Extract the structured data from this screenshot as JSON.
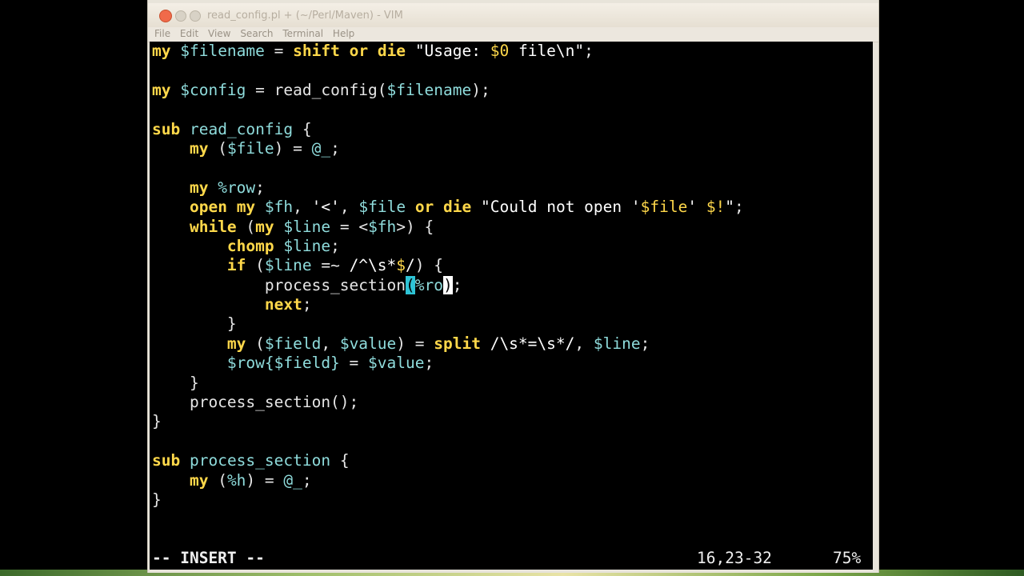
{
  "window": {
    "title": "read_config.pl + (~/Perl/Maven) - VIM"
  },
  "menubar": {
    "items": [
      "File",
      "Edit",
      "View",
      "Search",
      "Terminal",
      "Help"
    ]
  },
  "editor": {
    "lines": [
      [
        [
          "kw",
          "my"
        ],
        [
          "plain",
          " "
        ],
        [
          "var",
          "$filename"
        ],
        [
          "plain",
          " = "
        ],
        [
          "kw",
          "shift"
        ],
        [
          "plain",
          " "
        ],
        [
          "kw",
          "or"
        ],
        [
          "plain",
          " "
        ],
        [
          "kw",
          "die"
        ],
        [
          "plain",
          " "
        ],
        [
          "str",
          "\"Usage: "
        ],
        [
          "strvar",
          "$0"
        ],
        [
          "str",
          " file\\n\""
        ],
        [
          "plain",
          ";"
        ]
      ],
      [],
      [
        [
          "kw",
          "my"
        ],
        [
          "plain",
          " "
        ],
        [
          "var",
          "$config"
        ],
        [
          "plain",
          " = read_config("
        ],
        [
          "var",
          "$filename"
        ],
        [
          "plain",
          ");"
        ]
      ],
      [],
      [
        [
          "kw",
          "sub"
        ],
        [
          "plain",
          " "
        ],
        [
          "fn",
          "read_config"
        ],
        [
          "plain",
          " {"
        ]
      ],
      [
        [
          "plain",
          "    "
        ],
        [
          "kw",
          "my"
        ],
        [
          "plain",
          " ("
        ],
        [
          "var",
          "$file"
        ],
        [
          "plain",
          ") = "
        ],
        [
          "var",
          "@_"
        ],
        [
          "plain",
          ";"
        ]
      ],
      [],
      [
        [
          "plain",
          "    "
        ],
        [
          "kw",
          "my"
        ],
        [
          "plain",
          " "
        ],
        [
          "var",
          "%row"
        ],
        [
          "plain",
          ";"
        ]
      ],
      [
        [
          "plain",
          "    "
        ],
        [
          "kw",
          "open"
        ],
        [
          "plain",
          " "
        ],
        [
          "kw",
          "my"
        ],
        [
          "plain",
          " "
        ],
        [
          "var",
          "$fh"
        ],
        [
          "plain",
          ", "
        ],
        [
          "str",
          "'<'"
        ],
        [
          "plain",
          ", "
        ],
        [
          "var",
          "$file"
        ],
        [
          "plain",
          " "
        ],
        [
          "kw",
          "or"
        ],
        [
          "plain",
          " "
        ],
        [
          "kw",
          "die"
        ],
        [
          "plain",
          " "
        ],
        [
          "str",
          "\"Could not open '"
        ],
        [
          "strvar",
          "$file"
        ],
        [
          "str",
          "' "
        ],
        [
          "strvar",
          "$!"
        ],
        [
          "str",
          "\""
        ],
        [
          "plain",
          ";"
        ]
      ],
      [
        [
          "plain",
          "    "
        ],
        [
          "kw",
          "while"
        ],
        [
          "plain",
          " ("
        ],
        [
          "kw",
          "my"
        ],
        [
          "plain",
          " "
        ],
        [
          "var",
          "$line"
        ],
        [
          "plain",
          " = <"
        ],
        [
          "var",
          "$fh"
        ],
        [
          "plain",
          ">) {"
        ]
      ],
      [
        [
          "plain",
          "        "
        ],
        [
          "kw",
          "chomp"
        ],
        [
          "plain",
          " "
        ],
        [
          "var",
          "$line"
        ],
        [
          "plain",
          ";"
        ]
      ],
      [
        [
          "plain",
          "        "
        ],
        [
          "kw",
          "if"
        ],
        [
          "plain",
          " ("
        ],
        [
          "var",
          "$line"
        ],
        [
          "plain",
          " =~ "
        ],
        [
          "str",
          "/^\\s*"
        ],
        [
          "strvar",
          "$"
        ],
        [
          "str",
          "/"
        ],
        [
          "plain",
          ") {"
        ]
      ],
      [
        [
          "plain",
          "            process_section"
        ],
        [
          "hl-paren",
          "("
        ],
        [
          "var",
          "%ro"
        ],
        [
          "cursor",
          ")"
        ],
        [
          "plain",
          ";"
        ]
      ],
      [
        [
          "plain",
          "            "
        ],
        [
          "kw",
          "next"
        ],
        [
          "plain",
          ";"
        ]
      ],
      [
        [
          "plain",
          "        }"
        ]
      ],
      [
        [
          "plain",
          "        "
        ],
        [
          "kw",
          "my"
        ],
        [
          "plain",
          " ("
        ],
        [
          "var",
          "$field"
        ],
        [
          "plain",
          ", "
        ],
        [
          "var",
          "$value"
        ],
        [
          "plain",
          ") = "
        ],
        [
          "kw",
          "split"
        ],
        [
          "plain",
          " "
        ],
        [
          "str",
          "/\\s*=\\s*/"
        ],
        [
          "plain",
          ", "
        ],
        [
          "var",
          "$line"
        ],
        [
          "plain",
          ";"
        ]
      ],
      [
        [
          "plain",
          "        "
        ],
        [
          "var",
          "$row{$field}"
        ],
        [
          "plain",
          " = "
        ],
        [
          "var",
          "$value"
        ],
        [
          "plain",
          ";"
        ]
      ],
      [
        [
          "plain",
          "    }"
        ]
      ],
      [
        [
          "plain",
          "    process_section();"
        ]
      ],
      [
        [
          "plain",
          "}"
        ]
      ],
      [],
      [
        [
          "kw",
          "sub"
        ],
        [
          "plain",
          " "
        ],
        [
          "fn",
          "process_section"
        ],
        [
          "plain",
          " {"
        ]
      ],
      [
        [
          "plain",
          "    "
        ],
        [
          "kw",
          "my"
        ],
        [
          "plain",
          " ("
        ],
        [
          "var",
          "%h"
        ],
        [
          "plain",
          ") = "
        ],
        [
          "var",
          "@_"
        ],
        [
          "plain",
          ";"
        ]
      ],
      [
        [
          "plain",
          "}"
        ]
      ]
    ]
  },
  "statusline": {
    "mode": "-- INSERT --",
    "cursor_position": "16,23-32",
    "scroll_percent": "75%"
  },
  "colors": {
    "keyword": "#ffd84a",
    "variable": "#8fdcdc",
    "text": "#e6e6e6",
    "background": "#000000",
    "paren_highlight": "#2ec4d6",
    "close_button": "#f06a4a"
  }
}
